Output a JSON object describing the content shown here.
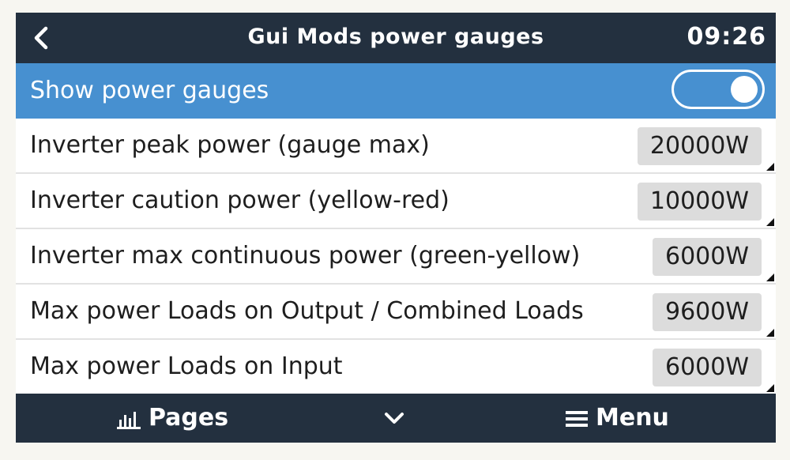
{
  "header": {
    "title": "Gui Mods power gauges",
    "time": "09:26"
  },
  "toggle_row": {
    "label": "Show power gauges",
    "state": "on"
  },
  "settings": [
    {
      "label": "Inverter peak power (gauge max)",
      "value": "20000W"
    },
    {
      "label": "Inverter caution power (yellow-red)",
      "value": "10000W"
    },
    {
      "label": "Inverter max continuous power (green-yellow)",
      "value": "6000W"
    },
    {
      "label": "Max power Loads on Output / Combined Loads",
      "value": "9600W"
    },
    {
      "label": "Max power Loads on Input",
      "value": "6000W"
    }
  ],
  "footer": {
    "pages_label": "Pages",
    "menu_label": "Menu"
  },
  "colors": {
    "header_bg": "#23303f",
    "highlight_bg": "#4790d0",
    "value_bg": "#dcdcdc"
  }
}
